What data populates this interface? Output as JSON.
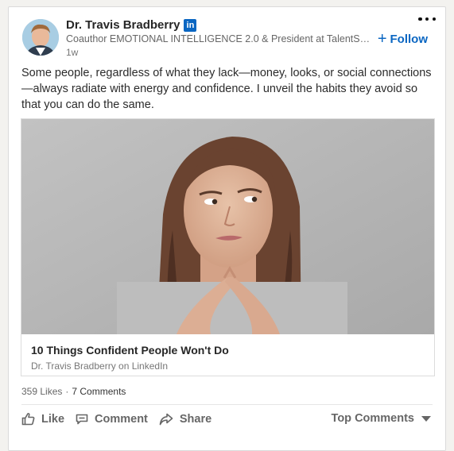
{
  "post": {
    "author": {
      "name": "Dr. Travis Bradberry",
      "badge": "in",
      "headline": "Coauthor EMOTIONAL INTELLIGENCE 2.0 & President at TalentSm...",
      "time": "1w"
    },
    "follow_label": "Follow",
    "follow_icon": "plus-icon",
    "more_icon": "more-options-icon",
    "text": "Some people, regardless of what they lack—money, looks, or social connections—always radiate with energy and confidence. I unveil the habits they avoid so that you can do the same.",
    "article": {
      "title": "10 Things Confident People Won't Do",
      "source": "Dr. Travis Bradberry on LinkedIn"
    },
    "social": {
      "likes": "359 Likes",
      "separator": "·",
      "comments": "7 Comments"
    },
    "actions": {
      "like": "Like",
      "comment": "Comment",
      "share": "Share"
    },
    "sort_label": "Top Comments",
    "colors": {
      "accent": "#0a66c2",
      "muted_text": "#666666",
      "card_border": "#dadada"
    }
  }
}
